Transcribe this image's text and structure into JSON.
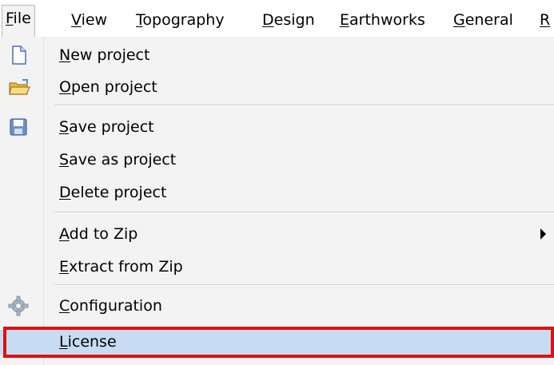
{
  "menubar": {
    "items": [
      {
        "label": "File",
        "accel": "F",
        "rest": "ile"
      },
      {
        "label": "View",
        "accel": "V",
        "rest": "iew"
      },
      {
        "label": "Topography",
        "accel": "T",
        "rest": "opography"
      },
      {
        "label": "Design",
        "accel": "D",
        "rest": "esign"
      },
      {
        "label": "Earthworks",
        "accel": "E",
        "rest": "arthworks"
      },
      {
        "label": "General",
        "accel": "G",
        "rest": "eneral"
      },
      {
        "label": "R",
        "accel": "R",
        "rest": ""
      }
    ]
  },
  "file_menu": {
    "items": [
      {
        "label": "New project",
        "accel": "N",
        "rest": "ew project",
        "icon": "new-document-icon"
      },
      {
        "label": "Open project",
        "accel": "O",
        "rest": "pen project",
        "icon": "open-folder-icon"
      },
      {
        "label": "Save project",
        "accel": "S",
        "rest": "ave project",
        "icon": "floppy-disk-icon"
      },
      {
        "label": "Save as project",
        "accel": "S",
        "rest": "ave as project"
      },
      {
        "label": "Delete project",
        "accel": "D",
        "rest": "elete project"
      },
      {
        "label": "Add to Zip",
        "accel": "A",
        "rest": "dd to Zip",
        "submenu": true
      },
      {
        "label": "Extract from Zip",
        "accel": "E",
        "rest": "xtract from Zip"
      },
      {
        "label": "Configuration",
        "accel": "C",
        "rest": "onfiguration",
        "icon": "gear-icon"
      },
      {
        "label": "License",
        "accel": "L",
        "rest": "icense",
        "highlighted": true
      }
    ]
  },
  "colors": {
    "highlight_bg": "#c7dcf3",
    "annotation_border": "#e01010"
  }
}
